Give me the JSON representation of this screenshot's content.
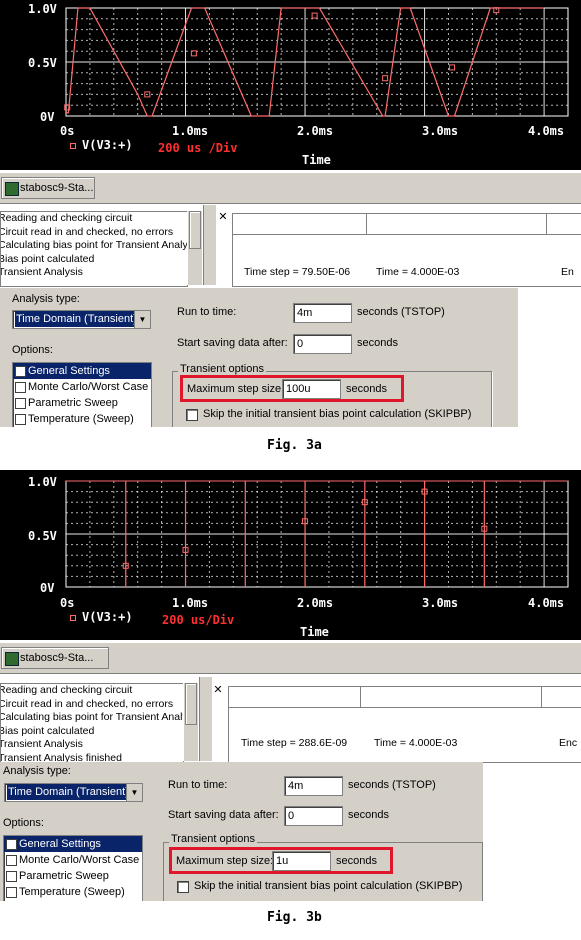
{
  "fig_a": {
    "plot": {
      "y_ticks": [
        "1.0V",
        "0.5V",
        "0V"
      ],
      "x_ticks": [
        "0s",
        "1.0ms",
        "2.0ms",
        "3.0ms",
        "4.0ms"
      ],
      "legend": "V(V3:+)",
      "annotation": "200 us /Div",
      "xlabel": "Time"
    },
    "task_button": "stabosc9-Sta...",
    "output_lines": [
      "Reading and checking circuit",
      "Circuit read in and checked, no errors",
      "Calculating bias point for Transient Analy",
      "Bias point calculated",
      "Transient Analysis"
    ],
    "status": {
      "time_step": "Time step = 79.50E-06",
      "time": "Time = 4.000E-03",
      "extra": "En"
    },
    "dialog": {
      "analysis_type_label": "Analysis type:",
      "analysis_type_value": "Time Domain (Transient)",
      "options_label": "Options:",
      "options": [
        "General Settings",
        "Monte Carlo/Worst Case",
        "Parametric Sweep",
        "Temperature (Sweep)"
      ],
      "run_to_time_label": "Run to time:",
      "run_to_time_value": "4m",
      "run_to_time_unit": "seconds  (TSTOP)",
      "start_saving_label": "Start saving data after:",
      "start_saving_value": "0",
      "start_saving_unit": "seconds",
      "transient_options_label": "Transient options",
      "max_step_label": "Maximum step size:",
      "max_step_value": "100u",
      "max_step_unit": "seconds",
      "skip_label": "Skip the initial transient bias point calculation  (SKIPBP)"
    },
    "caption": "Fig. 3a"
  },
  "fig_b": {
    "plot": {
      "y_ticks": [
        "1.0V",
        "0.5V",
        "0V"
      ],
      "x_ticks": [
        "0s",
        "1.0ms",
        "2.0ms",
        "3.0ms",
        "4.0ms"
      ],
      "legend": "V(V3:+)",
      "annotation": "200 us/Div",
      "xlabel": "Time"
    },
    "task_button": "stabosc9-Sta...",
    "output_lines": [
      "Reading and checking circuit",
      "Circuit read in and checked, no errors",
      "Calculating bias point for Transient Analy",
      "Bias point calculated",
      "Transient Analysis",
      "Transient Analysis finished"
    ],
    "status": {
      "time_step": "Time step = 288.6E-09",
      "time": "Time = 4.000E-03",
      "extra": "Enc"
    },
    "dialog": {
      "analysis_type_label": "Analysis type:",
      "analysis_type_value": "Time Domain (Transient)",
      "options_label": "Options:",
      "options": [
        "General Settings",
        "Monte Carlo/Worst Case",
        "Parametric Sweep",
        "Temperature (Sweep)"
      ],
      "run_to_time_label": "Run to time:",
      "run_to_time_value": "4m",
      "run_to_time_unit": "seconds  (TSTOP)",
      "start_saving_label": "Start saving data after:",
      "start_saving_value": "0",
      "start_saving_unit": "seconds",
      "transient_options_label": "Transient options",
      "max_step_label": "Maximum step size:",
      "max_step_value": "1u",
      "max_step_unit": "seconds",
      "skip_label": "Skip the initial transient bias point calculation  (SKIPBP)"
    },
    "caption": "Fig. 3b"
  },
  "colors": {
    "trace": "#ff6b6b",
    "grid": "#ffffff",
    "highlight": "#e0162b",
    "plot_bg": "#000000",
    "annotation": "#ff3030"
  },
  "waveforms": {
    "fig_a": {
      "t_ms": [
        0,
        0.02,
        0.1,
        0.2,
        0.6,
        0.68,
        0.72,
        1.05,
        1.12,
        1.16,
        1.55,
        1.7,
        1.8,
        2.08,
        2.12,
        2.65,
        2.67,
        2.8,
        2.88,
        3.2,
        3.25,
        3.55,
        3.7,
        4.0
      ],
      "v": [
        0.03,
        0.03,
        1.0,
        1.0,
        0.2,
        0.0,
        0.0,
        1.0,
        1.0,
        1.0,
        0.0,
        0.0,
        1.0,
        1.0,
        1.0,
        0.0,
        0.0,
        1.0,
        1.0,
        0.0,
        0.0,
        1.0,
        1.0,
        1.0
      ],
      "markers": [
        [
          0.01,
          0.08
        ],
        [
          0.68,
          0.2
        ],
        [
          1.07,
          0.58
        ],
        [
          2.08,
          0.93
        ],
        [
          2.67,
          0.35
        ],
        [
          3.23,
          0.45
        ],
        [
          3.6,
          0.98
        ]
      ]
    },
    "fig_b": {
      "pulses_ms": [
        0.5,
        1.0,
        1.5,
        2.0,
        2.5,
        3.0,
        3.5
      ],
      "markers": [
        [
          0.5,
          0.2
        ],
        [
          1.0,
          0.35
        ],
        [
          2.0,
          0.62
        ],
        [
          2.5,
          0.8
        ],
        [
          3.0,
          0.9
        ],
        [
          3.5,
          0.55
        ]
      ]
    }
  }
}
